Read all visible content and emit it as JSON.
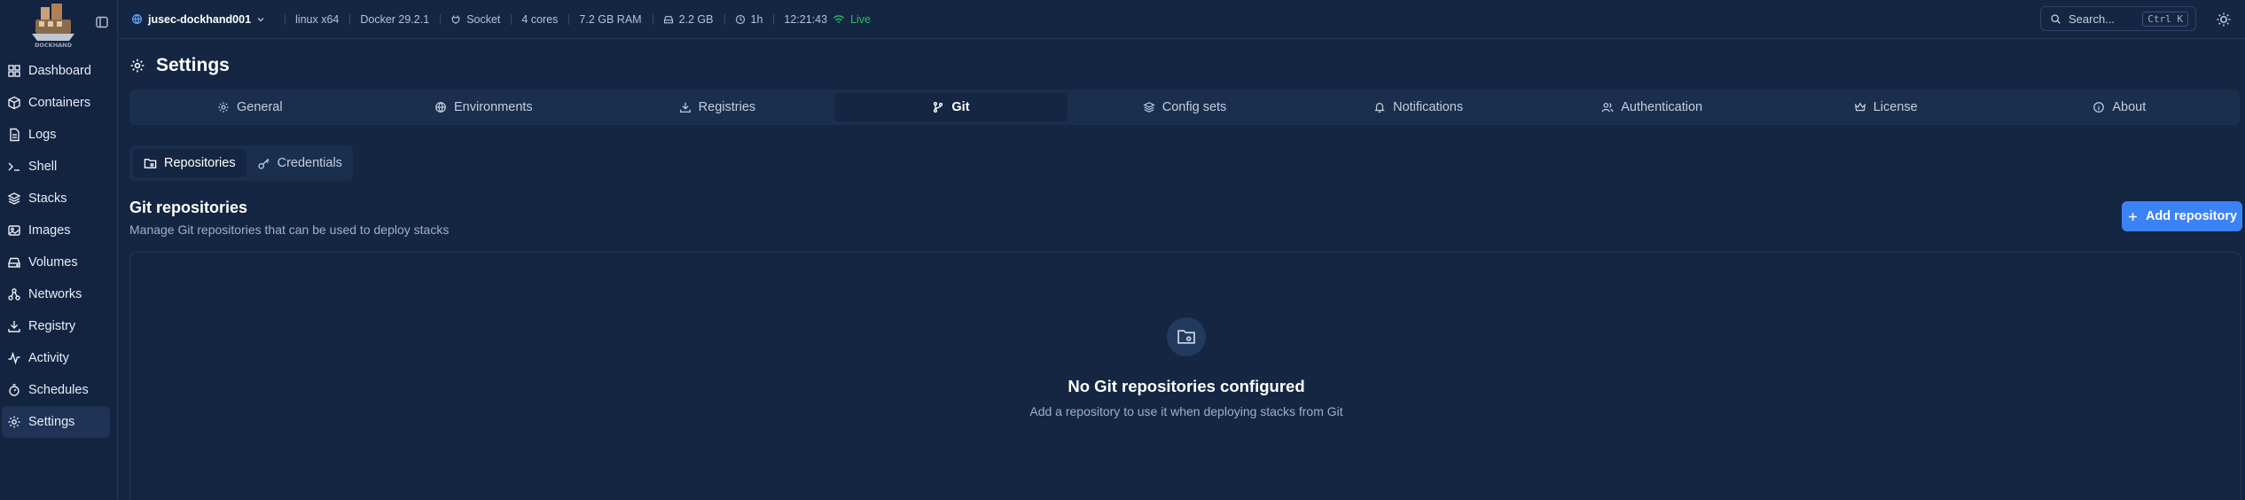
{
  "app": {
    "name": "DOCKHAND"
  },
  "sidebar": {
    "items": [
      {
        "label": "Dashboard",
        "icon": "dashboard-icon"
      },
      {
        "label": "Containers",
        "icon": "box-icon"
      },
      {
        "label": "Logs",
        "icon": "file-text-icon"
      },
      {
        "label": "Shell",
        "icon": "terminal-icon"
      },
      {
        "label": "Stacks",
        "icon": "layers-icon"
      },
      {
        "label": "Images",
        "icon": "images-icon"
      },
      {
        "label": "Volumes",
        "icon": "hard-drive-icon"
      },
      {
        "label": "Networks",
        "icon": "network-icon"
      },
      {
        "label": "Registry",
        "icon": "download-icon"
      },
      {
        "label": "Activity",
        "icon": "activity-icon"
      },
      {
        "label": "Schedules",
        "icon": "timer-icon"
      },
      {
        "label": "Settings",
        "icon": "gear-icon",
        "active": true
      }
    ]
  },
  "topbar": {
    "environment": "jusec-dockhand001",
    "platform": "linux x64",
    "docker": "Docker 29.2.1",
    "connection": "Socket",
    "cores": "4 cores",
    "ram": "7.2 GB RAM",
    "disk": "2.2 GB",
    "uptime": "1h",
    "time": "12:21:43",
    "status": "Live",
    "search_placeholder": "Search...",
    "search_shortcut": "Ctrl K"
  },
  "page": {
    "title": "Settings",
    "tabs": [
      {
        "label": "General",
        "icon": "gear-icon"
      },
      {
        "label": "Environments",
        "icon": "globe-icon"
      },
      {
        "label": "Registries",
        "icon": "download-icon"
      },
      {
        "label": "Git",
        "icon": "git-branch-icon",
        "active": true
      },
      {
        "label": "Config sets",
        "icon": "layers-icon"
      },
      {
        "label": "Notifications",
        "icon": "bell-icon"
      },
      {
        "label": "Authentication",
        "icon": "users-icon"
      },
      {
        "label": "License",
        "icon": "crown-icon"
      },
      {
        "label": "About",
        "icon": "info-icon"
      }
    ],
    "subtabs": [
      {
        "label": "Repositories",
        "icon": "folder-git-icon",
        "active": true
      },
      {
        "label": "Credentials",
        "icon": "key-icon"
      }
    ],
    "section": {
      "title": "Git repositories",
      "subtitle": "Manage Git repositories that can be used to deploy stacks",
      "add_button": "Add repository"
    },
    "empty_state": {
      "title": "No Git repositories configured",
      "subtitle": "Add a repository to use it when deploying stacks from Git"
    }
  },
  "colors": {
    "background": "#142642",
    "accent": "#3b82f6",
    "live": "#22c55e"
  }
}
